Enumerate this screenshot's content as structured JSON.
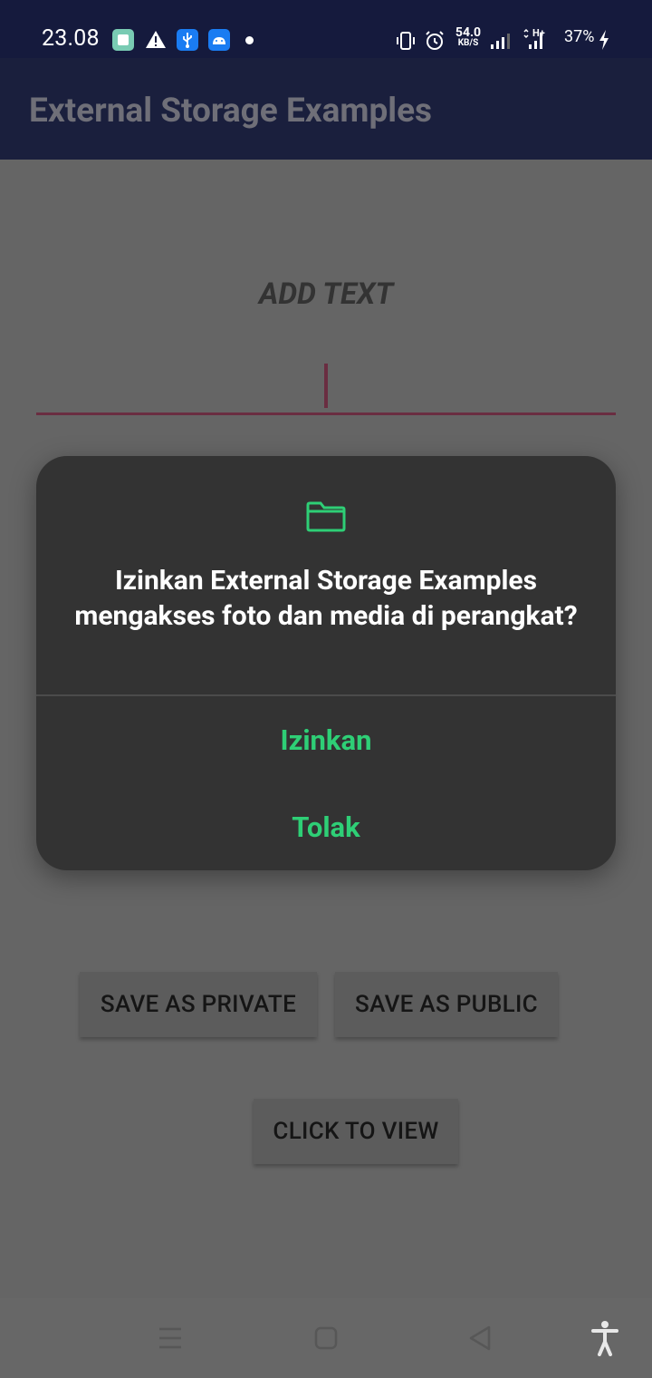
{
  "status_bar": {
    "time": "23.08",
    "network_speed_value": "54.0",
    "network_speed_unit": "KB/S",
    "network_type": "H+",
    "battery": "37%"
  },
  "app_bar": {
    "title": "External Storage Examples"
  },
  "main": {
    "heading": "ADD TEXT",
    "text_input_value": "",
    "buttons": {
      "save_private": "SAVE AS PRIVATE",
      "save_public": "SAVE AS PUBLIC",
      "view": "CLICK TO VIEW"
    }
  },
  "dialog": {
    "icon": "folder-icon",
    "message": "Izinkan External Storage Examples mengakses foto dan media di perangkat?",
    "allow_label": "Izinkan",
    "deny_label": "Tolak",
    "accent_color": "#2ecf76"
  },
  "nav_bar": {
    "icons": [
      "menu-icon",
      "home-icon",
      "back-icon",
      "accessibility-icon"
    ]
  }
}
